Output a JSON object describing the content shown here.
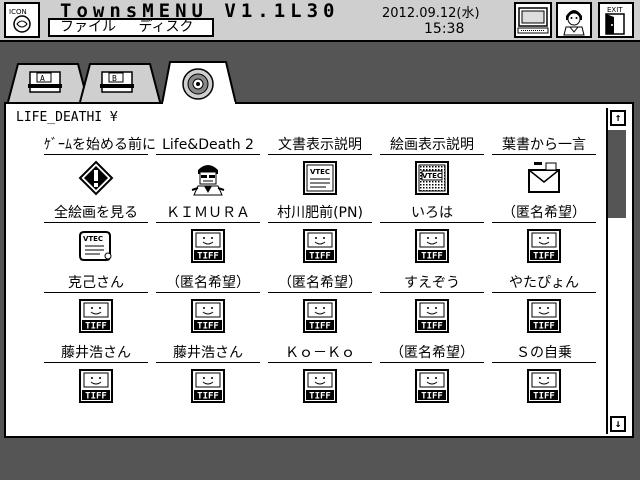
{
  "app": {
    "title": "TownsMENU V1.1L30",
    "menu": [
      "ファイル",
      "ディスク"
    ],
    "date": "2012.09.12(水)",
    "time": "15:38"
  },
  "toolbar": {
    "icon_button_label": "ICON",
    "exit_button_label": "EXIT"
  },
  "tabs": [
    {
      "name": "drive-a",
      "label": "A"
    },
    {
      "name": "drive-b",
      "label": "B"
    },
    {
      "name": "drive-cd",
      "label": ""
    }
  ],
  "window": {
    "path": "LIFE_DEATHI ¥"
  },
  "items": [
    {
      "label": "ｹﾞｰﾑを始める前に",
      "icon": "warning-icon"
    },
    {
      "label": "Life&Death 2",
      "icon": "doctor-icon"
    },
    {
      "label": "文書表示説明",
      "icon": "vtec-document-icon"
    },
    {
      "label": "絵画表示説明",
      "icon": "vtec-picture-icon"
    },
    {
      "label": "葉書から一言",
      "icon": "postcard-icon"
    },
    {
      "label": "全絵画を見る",
      "icon": "vtec-scroll-icon"
    },
    {
      "label": "ＫＩＭＵＲＡ",
      "icon": "tiff-icon"
    },
    {
      "label": "村川肥前(PN)",
      "icon": "tiff-icon"
    },
    {
      "label": "いろは",
      "icon": "tiff-icon"
    },
    {
      "label": "（匿名希望）",
      "icon": "tiff-icon"
    },
    {
      "label": "克己さん",
      "icon": "tiff-icon"
    },
    {
      "label": "（匿名希望）",
      "icon": "tiff-icon"
    },
    {
      "label": "（匿名希望）",
      "icon": "tiff-icon"
    },
    {
      "label": "すえぞう",
      "icon": "tiff-icon"
    },
    {
      "label": "やたぴょん",
      "icon": "tiff-icon"
    },
    {
      "label": "藤井浩さん",
      "icon": "tiff-icon"
    },
    {
      "label": "藤井浩さん",
      "icon": "tiff-icon"
    },
    {
      "label": "Ｋｏ－Ｋｏ",
      "icon": "tiff-icon"
    },
    {
      "label": "（匿名希望）",
      "icon": "tiff-icon"
    },
    {
      "label": "Ｓの自乗",
      "icon": "tiff-icon"
    }
  ],
  "tiff_label": "TIFF",
  "vtec_label": "VTEC",
  "scrollbar": {
    "up": "↑",
    "down": "↓"
  },
  "colors": {
    "background": "#555555",
    "topbar": "#cfcfcf",
    "window": "#ffffff"
  }
}
